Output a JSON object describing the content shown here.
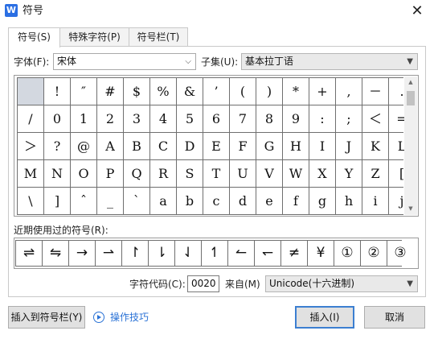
{
  "window": {
    "title": "符号",
    "app_icon": "W",
    "close_glyph": "✕"
  },
  "tabs": [
    {
      "label": "符号(S)",
      "active": true
    },
    {
      "label": "特殊字符(P)",
      "active": false
    },
    {
      "label": "符号栏(T)",
      "active": false
    }
  ],
  "font": {
    "label": "字体(F):",
    "value": "宋体"
  },
  "subset": {
    "label": "子集(U):",
    "value": "基本拉丁语"
  },
  "symbols": [
    " ",
    "!",
    "″",
    "#",
    "$",
    "%",
    "&",
    "’",
    "(",
    ")",
    "*",
    "+",
    ",",
    "－",
    ".",
    "/",
    "0",
    "1",
    "2",
    "3",
    "4",
    "5",
    "6",
    "7",
    "8",
    "9",
    ":",
    ";",
    "＜",
    "=",
    "＞",
    "?",
    "@",
    "A",
    "B",
    "C",
    "D",
    "E",
    "F",
    "G",
    "H",
    "I",
    "J",
    "K",
    "L",
    "M",
    "N",
    "O",
    "P",
    "Q",
    "R",
    "S",
    "T",
    "U",
    "V",
    "W",
    "X",
    "Y",
    "Z",
    "[",
    "\\",
    "]",
    "ˆ",
    "_",
    "`",
    "a",
    "b",
    "c",
    "d",
    "e",
    "f",
    "g",
    "h",
    "i",
    "j"
  ],
  "recent": {
    "label": "近期使用过的符号(R):",
    "symbols": [
      "⇌",
      "⇋",
      "→",
      "⇀",
      "↾",
      "⇂",
      "⇃",
      "↿",
      "↼",
      "↽",
      "≠",
      "¥",
      "①",
      "②",
      "③"
    ]
  },
  "char_code": {
    "label": "字符代码(C):",
    "value": "0020"
  },
  "from": {
    "label": "来自(M)",
    "value": "Unicode(十六进制)"
  },
  "buttons": {
    "insert_to_bar": "插入到符号栏(Y)",
    "tips": "操作技巧",
    "insert": "插入(I)",
    "cancel": "取消"
  }
}
